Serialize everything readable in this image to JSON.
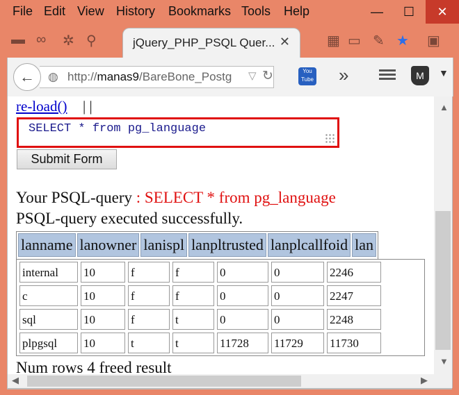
{
  "menu": {
    "file": "File",
    "edit": "Edit",
    "view": "View",
    "history": "History",
    "bookmarks": "Bookmarks",
    "tools": "Tools",
    "help": "Help"
  },
  "tab": {
    "title": "jQuery_PHP_PSQL Quer...",
    "close": "✕"
  },
  "nav": {
    "url_prefix": "http://",
    "url_host": "manas9",
    "url_path": "/BareBone_Postg"
  },
  "page": {
    "reload_link": "re-load()",
    "separators": " | |",
    "sql_value": "SELECT * from pg_language",
    "submit_label": "Submit Form",
    "query_label": "Your PSQL-query",
    "query_value": " : SELECT * from pg_language",
    "status": "PSQL-query executed successfully.",
    "columns": [
      "lanname",
      "lanowner",
      "lanispl",
      "lanpltrusted",
      "lanplcallfoid",
      "lan"
    ],
    "rows": [
      [
        "internal",
        "10",
        "f",
        "f",
        "0",
        "0",
        "2246"
      ],
      [
        "c",
        "10",
        "f",
        "f",
        "0",
        "0",
        "2247"
      ],
      [
        "sql",
        "10",
        "f",
        "t",
        "0",
        "0",
        "2248"
      ],
      [
        "plpgsql",
        "10",
        "t",
        "t",
        "11728",
        "11729",
        "11730"
      ]
    ],
    "footer": "Num rows 4 freed result"
  },
  "colors": {
    "titlebar": "#e98668",
    "close": "#c73a2a",
    "query_red": "#e01010",
    "header_cell": "#b1c5df",
    "link": "#0000cc"
  }
}
